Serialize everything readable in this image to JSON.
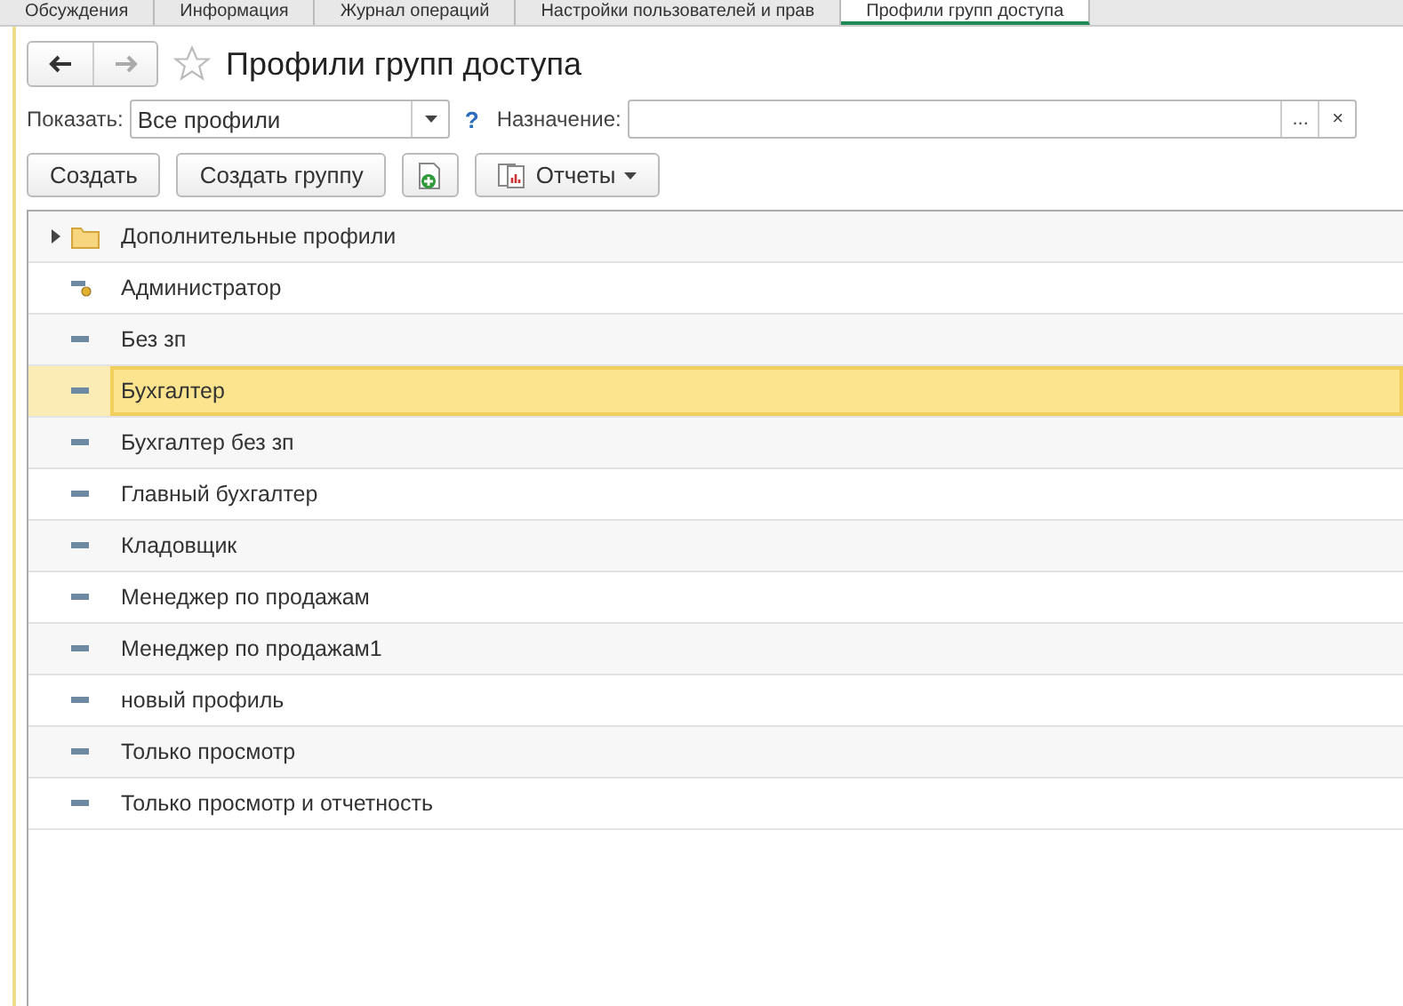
{
  "tabs": [
    {
      "label": "Обсуждения",
      "selected": false
    },
    {
      "label": "Информация",
      "selected": false
    },
    {
      "label": "Журнал операций",
      "selected": false
    },
    {
      "label": "Настройки пользователей и прав",
      "selected": false
    },
    {
      "label": "Профили групп доступа",
      "selected": true
    }
  ],
  "title": "Профили групп доступа",
  "filter": {
    "show_label": "Показать:",
    "show_value": "Все профили",
    "help": "?",
    "purpose_label": "Назначение:",
    "pick": "...",
    "clear": "×"
  },
  "toolbar": {
    "create": "Создать",
    "create_group": "Создать группу",
    "reports": "Отчеты"
  },
  "rows": [
    {
      "kind": "folder",
      "name": "Дополнительные профили",
      "expanded": false,
      "selected": false
    },
    {
      "kind": "admin",
      "name": "Администратор",
      "selected": false
    },
    {
      "kind": "profile",
      "name": "Без зп",
      "selected": false
    },
    {
      "kind": "profile",
      "name": "Бухгалтер",
      "selected": true
    },
    {
      "kind": "profile",
      "name": "Бухгалтер без зп",
      "selected": false
    },
    {
      "kind": "profile",
      "name": "Главный бухгалтер",
      "selected": false
    },
    {
      "kind": "profile",
      "name": "Кладовщик",
      "selected": false
    },
    {
      "kind": "profile",
      "name": "Менеджер по продажам",
      "selected": false
    },
    {
      "kind": "profile",
      "name": "Менеджер по продажам1",
      "selected": false
    },
    {
      "kind": "profile",
      "name": "новый профиль",
      "selected": false
    },
    {
      "kind": "profile",
      "name": "Только просмотр",
      "selected": false
    },
    {
      "kind": "profile",
      "name": "Только просмотр и отчетность",
      "selected": false
    }
  ]
}
